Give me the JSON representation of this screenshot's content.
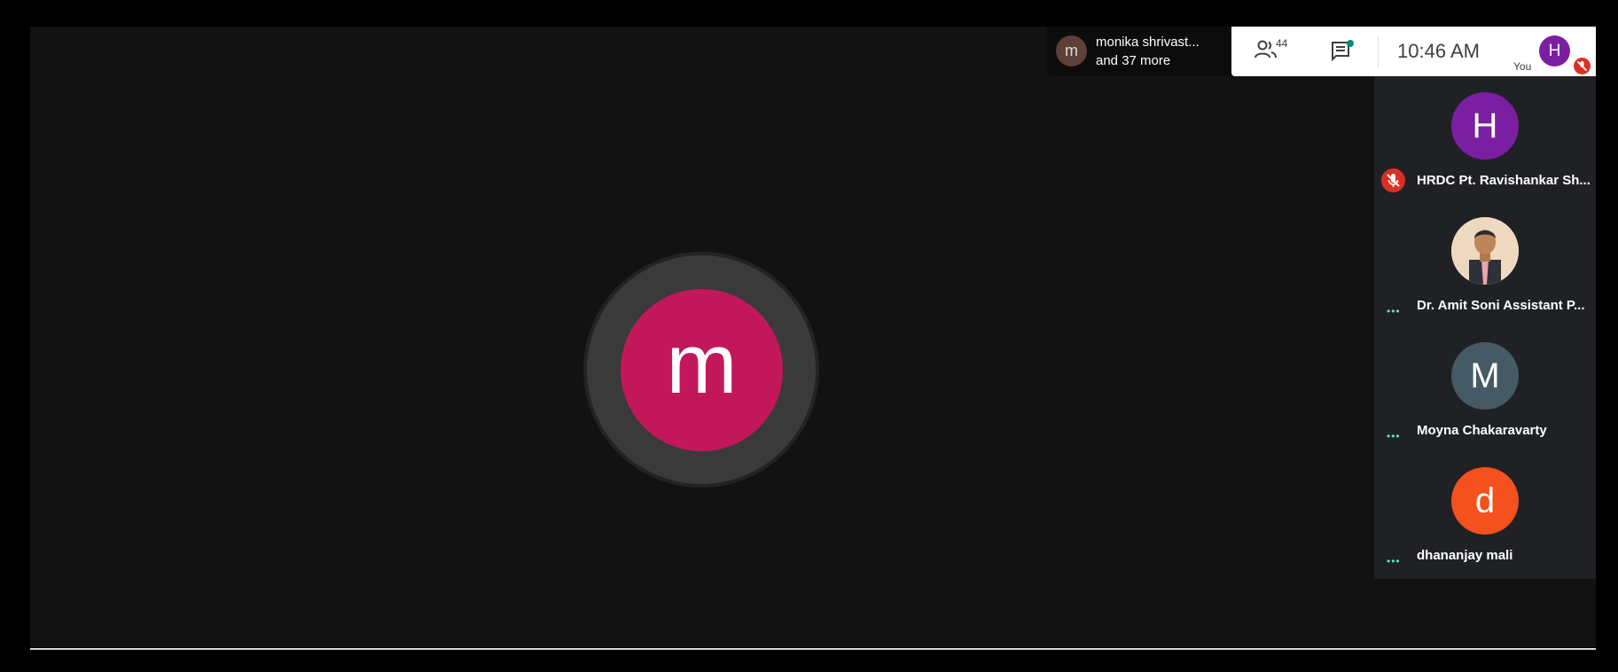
{
  "colors": {
    "speaker_avatar": "#c2185b",
    "chip_avatar": "#5d4037",
    "self_avatar": "#7b1fa2",
    "mic_off": "#d93025",
    "tile_h": "#7b1fa2",
    "tile_m": "#455a64",
    "tile_d": "#f4511e"
  },
  "speaker": {
    "initial": "m"
  },
  "presenter_chip": {
    "initial": "m",
    "name": "monika shrivast...",
    "more": "and 37 more"
  },
  "toolbar": {
    "people_count": "44",
    "people_icon": "people-icon",
    "chat_icon": "chat-icon",
    "time": "10:46  AM",
    "you_label": "You",
    "self_initial": "H",
    "mic_icon": "mic-off-icon"
  },
  "participants": [
    {
      "initial": "H",
      "name": "HRDC Pt. Ravishankar Sh...",
      "status": "muted"
    },
    {
      "initial": "",
      "name": "Dr. Amit Soni Assistant P...",
      "status": "dots"
    },
    {
      "initial": "M",
      "name": "Moyna Chakaravarty",
      "status": "dots"
    },
    {
      "initial": "d",
      "name": "dhananjay mali",
      "status": "dots"
    }
  ]
}
